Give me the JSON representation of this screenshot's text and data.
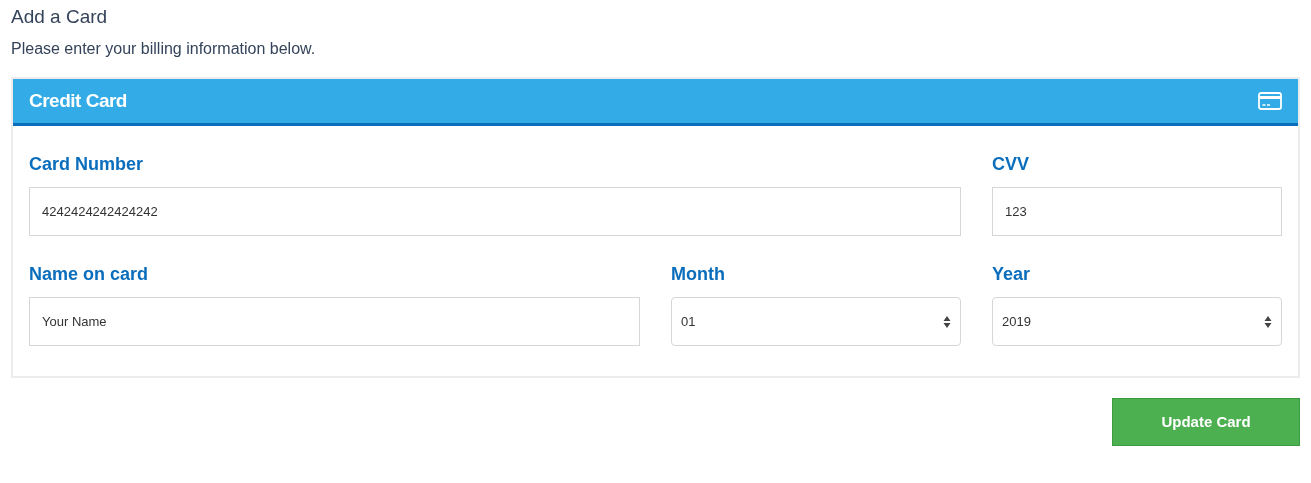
{
  "page": {
    "title": "Add a Card",
    "subtitle": "Please enter your billing information below."
  },
  "panel": {
    "title": "Credit Card",
    "fields": [
      {
        "label": "Card Number",
        "kind": "input",
        "value": "4242424242424242"
      },
      {
        "label": "CVV",
        "kind": "input",
        "value": "123"
      },
      {
        "label": "Name on card",
        "kind": "input",
        "value": "Your Name"
      },
      {
        "label": "Month",
        "kind": "select",
        "value": "01"
      },
      {
        "label": "Year",
        "kind": "select",
        "value": "2019"
      }
    ]
  },
  "button": {
    "label": "Update Card"
  }
}
